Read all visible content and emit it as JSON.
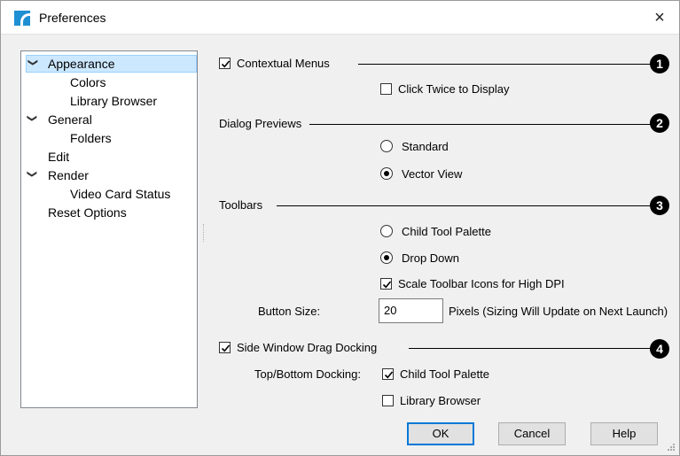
{
  "window": {
    "title": "Preferences",
    "close_glyph": "×"
  },
  "tree": {
    "items": [
      {
        "label": "Appearance",
        "expanded": true,
        "selected": true
      },
      {
        "label": "Colors"
      },
      {
        "label": "Library Browser"
      },
      {
        "label": "General",
        "expanded": true
      },
      {
        "label": "Folders"
      },
      {
        "label": "Edit"
      },
      {
        "label": "Render",
        "expanded": true
      },
      {
        "label": "Video Card Status"
      },
      {
        "label": "Reset Options"
      }
    ],
    "chevron_glyph": "❯"
  },
  "contextual_menus": {
    "label": "Contextual Menus",
    "checked": true,
    "badge": "1",
    "click_twice": {
      "label": "Click Twice to Display",
      "checked": false
    }
  },
  "dialog_previews": {
    "heading": "Dialog Previews",
    "badge": "2",
    "options": [
      {
        "label": "Standard",
        "selected": false
      },
      {
        "label": "Vector View",
        "selected": true
      }
    ]
  },
  "toolbars": {
    "heading": "Toolbars",
    "badge": "3",
    "options": [
      {
        "label": "Child Tool Palette",
        "selected": false
      },
      {
        "label": "Drop Down",
        "selected": true
      }
    ],
    "scale_icons": {
      "label": "Scale Toolbar Icons for High DPI",
      "checked": true
    },
    "button_size": {
      "label": "Button Size:",
      "value": "20",
      "note": "Pixels (Sizing Will Update on Next Launch)"
    }
  },
  "docking": {
    "label": "Side Window Drag Docking",
    "checked": true,
    "badge": "4",
    "top_bottom_label": "Top/Bottom Docking:",
    "child_tool_palette": {
      "label": "Child Tool Palette",
      "checked": true
    },
    "library_browser": {
      "label": "Library Browser",
      "checked": false
    }
  },
  "buttons": {
    "ok": "OK",
    "cancel": "Cancel",
    "help": "Help"
  },
  "colors": {
    "selection": "#cce8ff",
    "default_button_border": "#0078d7",
    "app_icon": "#1f8fd3"
  }
}
